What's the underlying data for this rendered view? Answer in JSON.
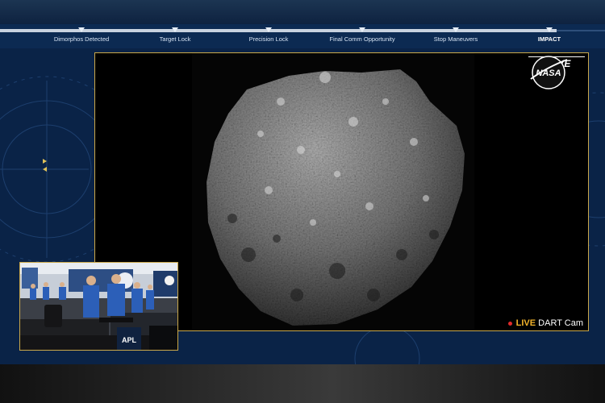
{
  "timeline": {
    "milestones": [
      {
        "label": "Dimorphos Detected"
      },
      {
        "label": "Target Lock"
      },
      {
        "label": "Precision Lock"
      },
      {
        "label": "Final Comm Opportunity"
      },
      {
        "label": "Stop Maneuvers"
      },
      {
        "label": "IMPACT"
      }
    ]
  },
  "feed": {
    "logo_text": "NASA",
    "live_label": "LIVE",
    "cam_live_label": "LIVE",
    "cam_name": "DART Cam"
  },
  "pip": {
    "badge_text": "APL"
  },
  "colors": {
    "frame_gold": "#caa84a",
    "live_red": "#e12a2a",
    "cam_live_yellow": "#f2b32a",
    "hud_blue": "#0a2347"
  }
}
